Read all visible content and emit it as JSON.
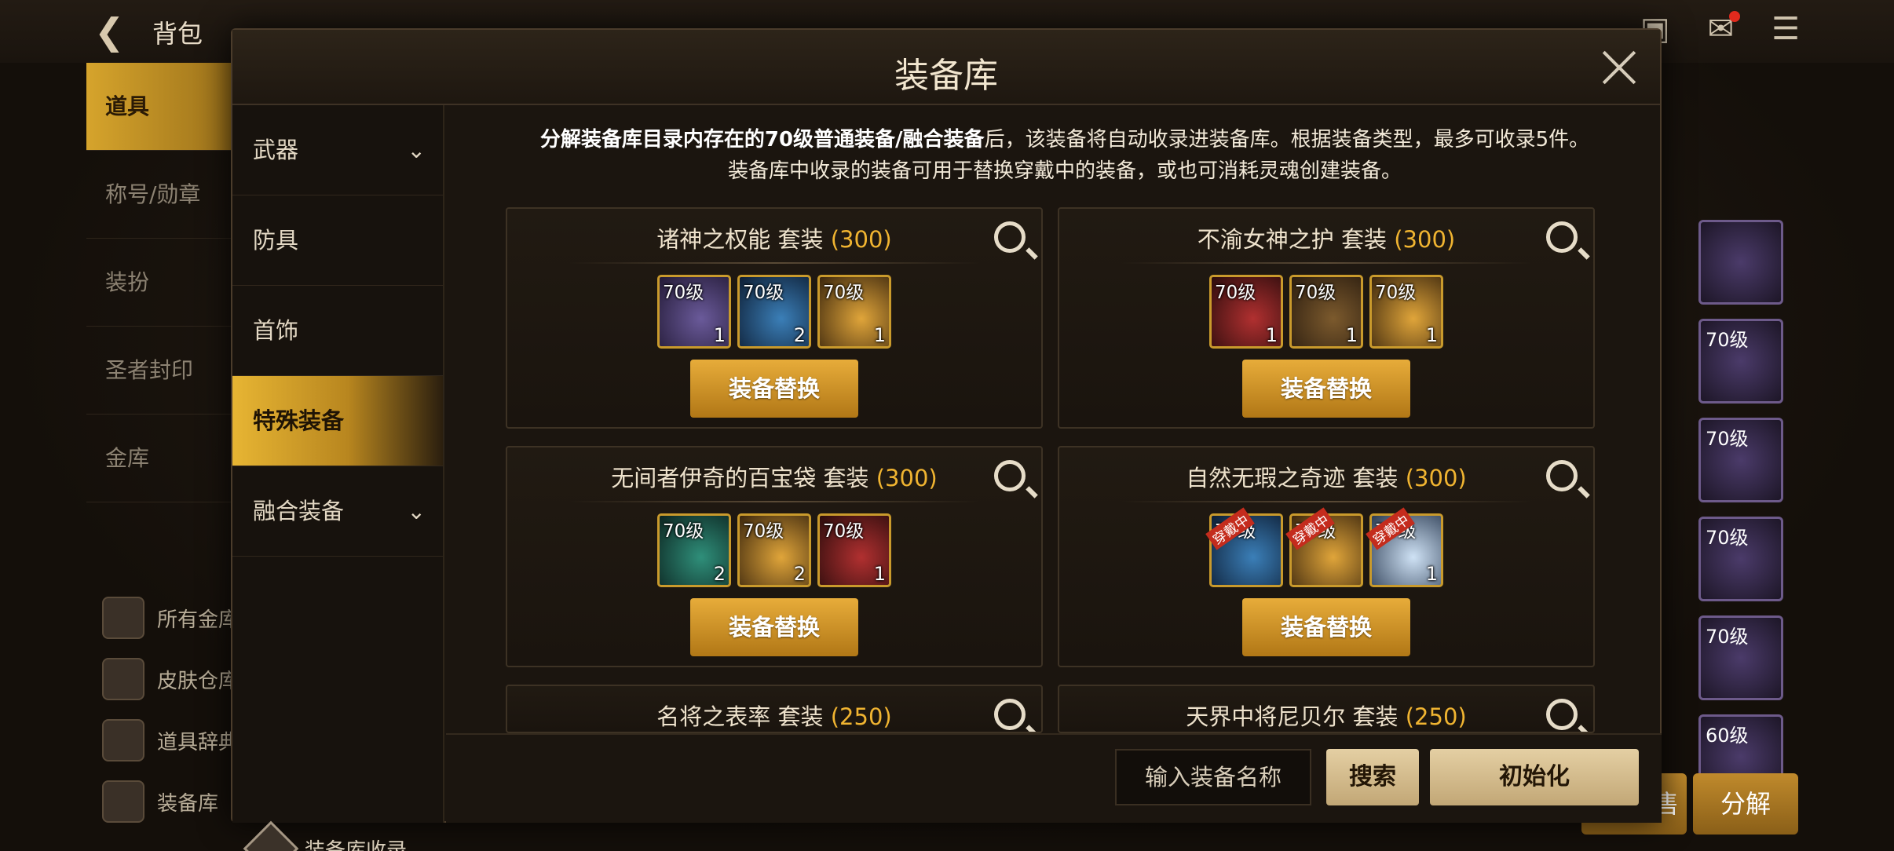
{
  "background": {
    "back_icon": "back-arrow-icon",
    "bag_title": "背包",
    "nav": [
      "道具",
      "称号/勋章",
      "装扮",
      "圣者封印",
      "金库"
    ],
    "side_links": [
      "所有金库",
      "皮肤仓库",
      "道具辞典",
      "装备库"
    ],
    "grid_levels": [
      "70级",
      "70级",
      "70级",
      "70级",
      "70级",
      "60级"
    ],
    "sell_label": "售",
    "decompose_label": "分解"
  },
  "modal": {
    "title": "装备库",
    "categories": [
      {
        "label": "武器",
        "expandable": true
      },
      {
        "label": "防具",
        "expandable": false
      },
      {
        "label": "首饰",
        "expandable": false
      },
      {
        "label": "特殊装备",
        "expandable": false,
        "active": true
      },
      {
        "label": "融合装备",
        "expandable": true
      }
    ],
    "footer_label": "装备库收录",
    "description_line1_bold": "分解装备库目录内存在的70级普通装备/融合装备",
    "description_line1_rest": "后，该装备将自动收录进装备库。根据装备类型，最多可收录5件。",
    "description_line2": "装备库中收录的装备可用于替换穿戴中的装备，或也可消耗灵魂创建装备。",
    "replace_label": "装备替换",
    "sets": [
      {
        "name": "诸神之权能",
        "type": "套装",
        "points": "(300)",
        "items": [
          {
            "level": "70级",
            "count": "1",
            "color": "purple"
          },
          {
            "level": "70级",
            "count": "2",
            "color": "gold"
          },
          {
            "level": "70级",
            "count": "1",
            "color": "gold"
          }
        ]
      },
      {
        "name": "不渝女神之护",
        "type": "套装",
        "points": "(300)",
        "items": [
          {
            "level": "70级",
            "count": "1",
            "color": "blue"
          },
          {
            "level": "70级",
            "count": "1",
            "color": "gold"
          },
          {
            "level": "70级",
            "count": "1",
            "color": "gold"
          }
        ]
      },
      {
        "name": "无间者伊奇的百宝袋",
        "type": "套装",
        "points": "(300)",
        "items": [
          {
            "level": "70级",
            "count": "2",
            "color": "teal"
          },
          {
            "level": "70级",
            "count": "2",
            "color": "gold"
          },
          {
            "level": "70级",
            "count": "1",
            "color": "gold"
          }
        ]
      },
      {
        "name": "自然无瑕之奇迹",
        "type": "套装",
        "points": "(300)",
        "items": [
          {
            "level": "70级",
            "count": "",
            "color": "blue",
            "wearing": "穿戴中"
          },
          {
            "level": "70级",
            "count": "",
            "color": "gold",
            "wearing": "穿戴中"
          },
          {
            "level": "70级",
            "count": "1",
            "color": "white",
            "wearing": "穿戴中"
          }
        ]
      },
      {
        "name": "名将之表率",
        "type": "套装",
        "points": "(250)"
      },
      {
        "name": "天界中将尼贝尔",
        "type": "套装",
        "points": "(250)"
      }
    ],
    "search_placeholder": "输入装备名称",
    "search_label": "搜索",
    "reset_label": "初始化"
  }
}
